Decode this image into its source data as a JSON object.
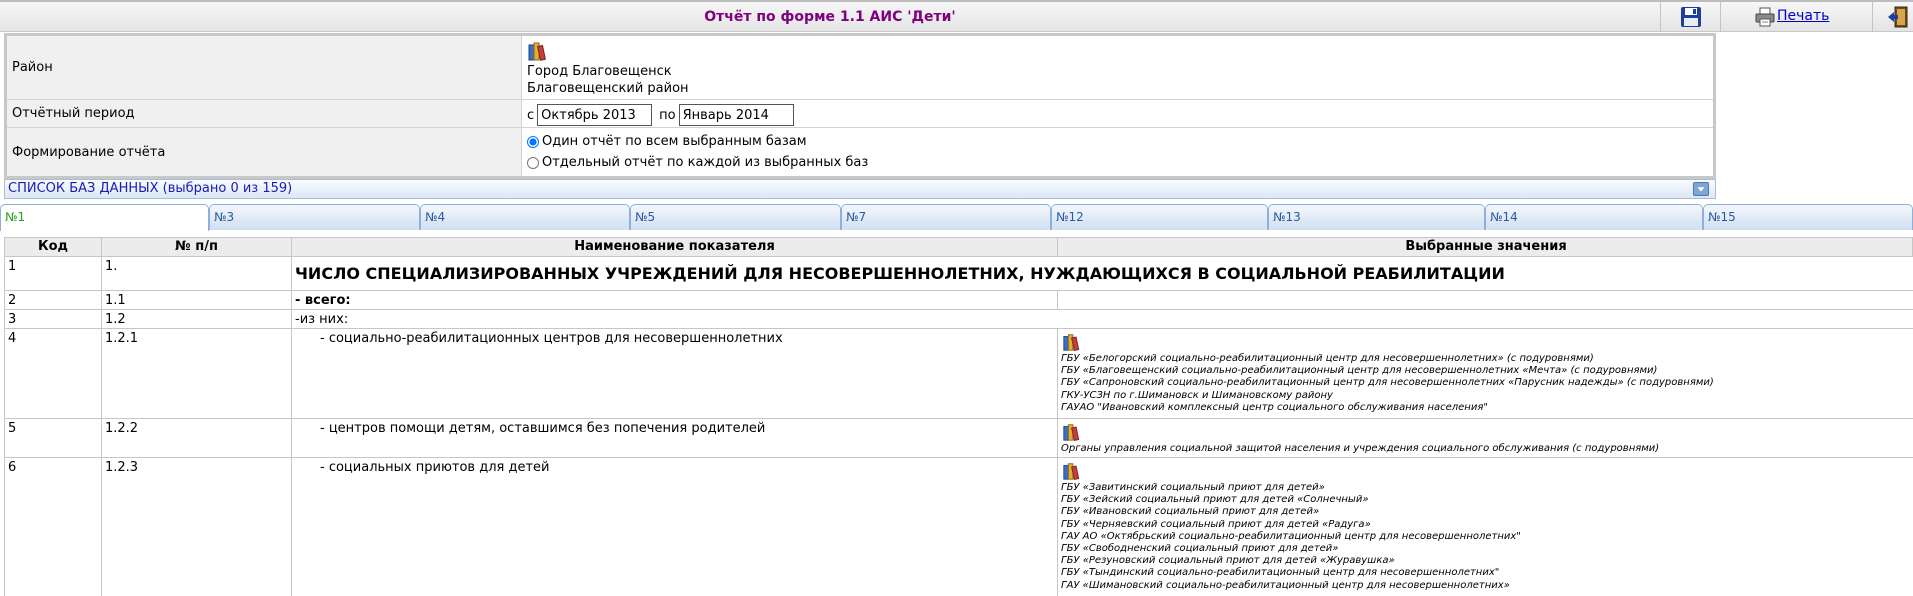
{
  "header": {
    "title": "Отчёт по форме 1.1 АИС 'Дети'",
    "print_label": "Печать"
  },
  "form": {
    "district_label": "Район",
    "district_values": [
      "Город Благовещенск",
      "Благовещенский район"
    ],
    "period_label": "Отчётный период",
    "period_from_prefix": "с",
    "period_from": "Октябрь 2013",
    "period_to_prefix": "по",
    "period_to": "Январь 2014",
    "mode_label": "Формирование отчёта",
    "mode_options": [
      "Один отчёт по всем выбранным базам",
      "Отдельный отчёт по каждой из выбранных баз"
    ],
    "mode_selected": 0
  },
  "dblist": {
    "label": "СПИСОК БАЗ ДАННЫХ (выбрано 0 из 159)"
  },
  "tabs": [
    {
      "label": "№1",
      "active": true
    },
    {
      "label": "№3"
    },
    {
      "label": "№4"
    },
    {
      "label": "№5"
    },
    {
      "label": "№7"
    },
    {
      "label": "№12"
    },
    {
      "label": "№13"
    },
    {
      "label": "№14"
    },
    {
      "label": "№15"
    }
  ],
  "table": {
    "columns": [
      "Код",
      "№ п/п",
      "Наименование показателя",
      "Выбранные значения"
    ],
    "rows": [
      {
        "kod": "1",
        "np": "1.",
        "name": "ЧИСЛО СПЕЦИАЛИЗИРОВАННЫХ УЧРЕЖДЕНИЙ ДЛЯ НЕСОВЕРШЕННОЛЕТНИХ, НУЖДАЮЩИХСЯ В СОЦИАЛЬНОЙ РЕАБИЛИТАЦИИ",
        "values": []
      },
      {
        "kod": "2",
        "np": "1.1",
        "name": "- всего:",
        "values": []
      },
      {
        "kod": "3",
        "np": "1.2",
        "name": "-из них:",
        "values": []
      },
      {
        "kod": "4",
        "np": "1.2.1",
        "name": "- социально-реабилитационных центров для несовершеннолетних",
        "values": [
          "ГБУ «Белогорский социально-реабилитационный центр для несовершеннолетних» (с подуровнями)",
          "ГБУ «Благовещенский социально-реабилитационный центр для несовершеннолетних «Мечта» (с подуровнями)",
          "ГБУ «Сапроновский социально-реабилитационный центр для несовершеннолетних «Парусник надежды» (с подуровнями)",
          "ГКУ-УСЗН по г.Шимановск и Шимановскому району",
          "ГАУАО \"Ивановский комплексный центр социального обслуживания населения\""
        ]
      },
      {
        "kod": "5",
        "np": "1.2.2",
        "name": "- центров помощи детям, оставшимся без попечения родителей",
        "values": [
          "Органы управления социальной защитой населения и учреждения социального обслуживания (с подуровнями)"
        ]
      },
      {
        "kod": "6",
        "np": "1.2.3",
        "name": "- социальных приютов для детей",
        "values": [
          "ГБУ «Завитинский социальный приют для детей»",
          "ГБУ «Зейский социальный приют для детей «Солнечный»",
          "ГБУ «Ивановский социальный приют для детей»",
          "ГБУ «Черняевский социальный приют для детей «Радуга»",
          "ГАУ АО «Октябрьский социально-реабилитационный центр для несовершеннолетних\"",
          "ГБУ «Свободненский социальный приют для детей»",
          "ГБУ «Резуновский социальный приют для детей «Журавушка»",
          "ГБУ «Тындинский социально-реабилитационный центр для несовершеннолетних\"",
          "ГАУ «Шимановский социально-реабилитационный центр для несовершеннолетних»"
        ]
      }
    ]
  }
}
